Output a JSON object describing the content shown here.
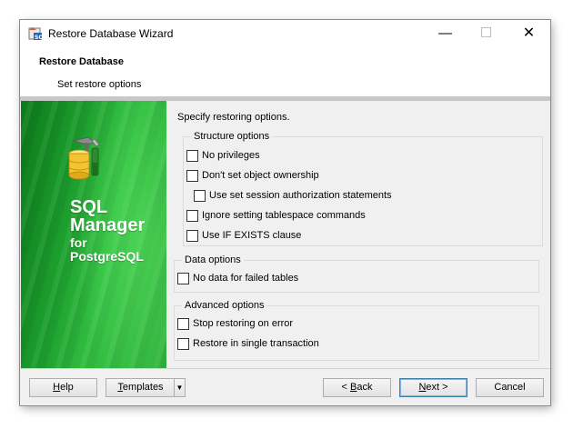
{
  "window": {
    "title": "Restore Database Wizard",
    "controls": {
      "minimize": "—",
      "maximize": "☐",
      "close": "✕"
    }
  },
  "header": {
    "title": "Restore Database",
    "subtitle": "Set restore options"
  },
  "banner": {
    "product_line1": "SQL",
    "product_line2": "Manager",
    "product_line3": "for",
    "product_line4": "PostgreSQL",
    "icon": "database-tools-icon"
  },
  "content": {
    "instruction": "Specify restoring options.",
    "structure_options": {
      "legend": "Structure options",
      "items": [
        {
          "label": "No privileges",
          "checked": false
        },
        {
          "label": "Don't set object ownership",
          "checked": false
        },
        {
          "label": "Use set session authorization statements",
          "checked": false
        },
        {
          "label": "Ignore setting tablespace commands",
          "checked": false
        },
        {
          "label": "Use IF EXISTS clause",
          "checked": false
        }
      ]
    },
    "data_options": {
      "legend": "Data options",
      "items": [
        {
          "label": "No data for failed tables",
          "checked": false
        }
      ]
    },
    "advanced_options": {
      "legend": "Advanced options",
      "items": [
        {
          "label": "Stop restoring on error",
          "checked": false
        },
        {
          "label": "Restore in single transaction",
          "checked": false
        }
      ]
    }
  },
  "footer": {
    "help": {
      "mnemonic": "H",
      "rest": "elp"
    },
    "templates": {
      "mnemonic": "T",
      "rest": "emplates"
    },
    "back": {
      "prefix": "< ",
      "mnemonic": "B",
      "rest": "ack"
    },
    "next": {
      "mnemonic": "N",
      "rest": "ext >"
    },
    "cancel": "Cancel"
  },
  "colors": {
    "banner_green": "#1da02e",
    "dialog_bg": "#f0f0f0",
    "default_button_border": "#3c7fb1"
  }
}
